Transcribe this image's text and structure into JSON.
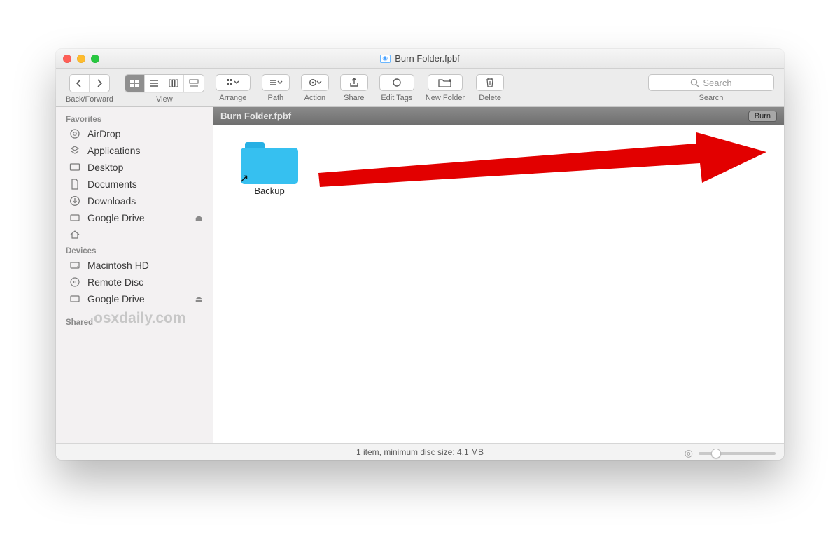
{
  "window": {
    "title": "Burn Folder.fpbf"
  },
  "toolbar": {
    "back_forward": "Back/Forward",
    "view": "View",
    "arrange": "Arrange",
    "path": "Path",
    "action": "Action",
    "share": "Share",
    "edit_tags": "Edit Tags",
    "new_folder": "New Folder",
    "delete": "Delete",
    "search_label": "Search",
    "search_placeholder": "Search"
  },
  "sidebar": {
    "favorites_header": "Favorites",
    "devices_header": "Devices",
    "shared_header": "Shared",
    "favorites": [
      {
        "label": "AirDrop"
      },
      {
        "label": "Applications"
      },
      {
        "label": "Desktop"
      },
      {
        "label": "Documents"
      },
      {
        "label": "Downloads"
      },
      {
        "label": "Google Drive",
        "eject": true
      },
      {
        "label": ""
      }
    ],
    "devices": [
      {
        "label": "Macintosh HD"
      },
      {
        "label": "Remote Disc"
      },
      {
        "label": "Google Drive",
        "eject": true
      }
    ]
  },
  "pathbar": {
    "title": "Burn Folder.fpbf",
    "burn_label": "Burn"
  },
  "files": [
    {
      "name": "Backup"
    }
  ],
  "status": {
    "text": "1 item, minimum disc size: 4.1 MB"
  },
  "watermark": "osxdaily.com"
}
